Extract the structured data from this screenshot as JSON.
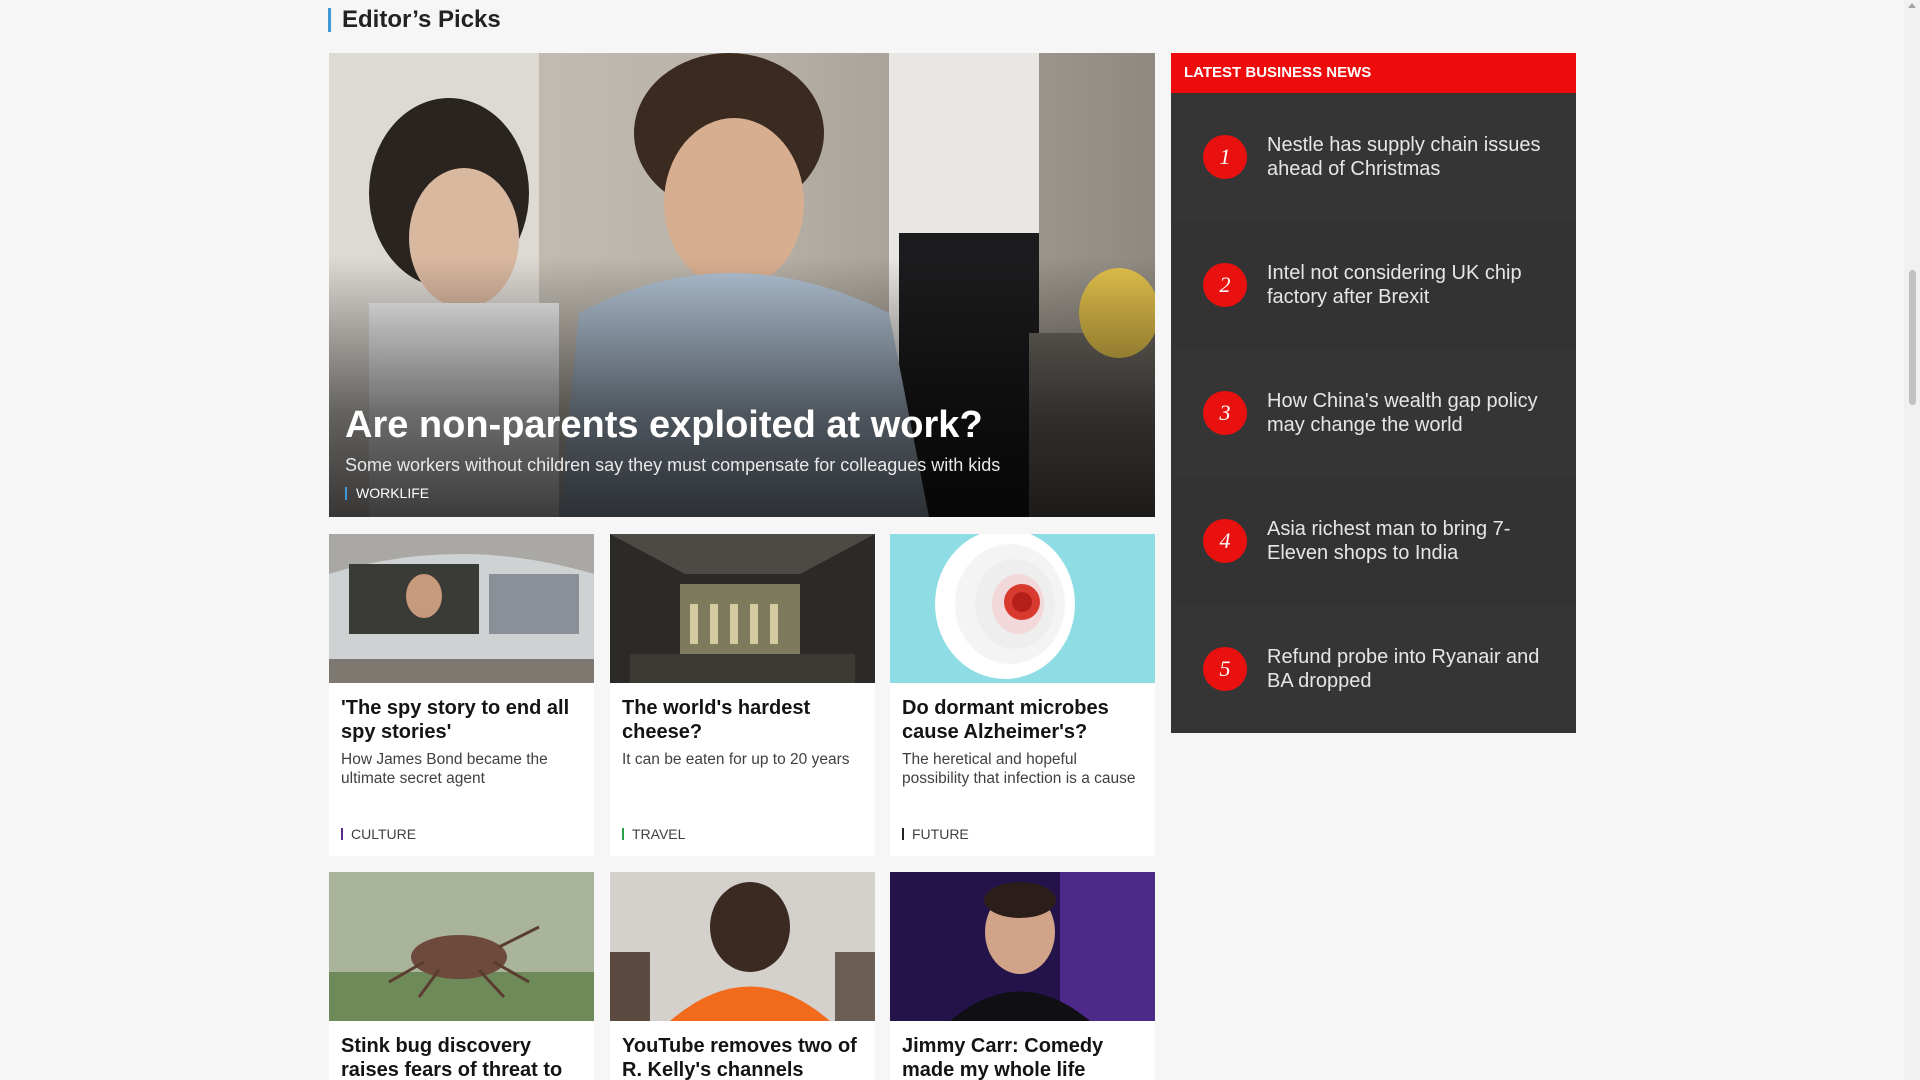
{
  "section": {
    "title": "Editor’s Picks"
  },
  "hero": {
    "title": "Are non-parents exploited at work?",
    "summary": "Some workers without children say they must compensate for colleagues with kids",
    "tag": "WORKLIFE",
    "image": "office-workers-photo"
  },
  "cards": [
    {
      "title": "'The spy story to end all spy stories'",
      "summary": "How James Bond became the ultimate secret agent",
      "tag": "CULTURE",
      "image": "man-in-car-photo"
    },
    {
      "title": "The world's hardest cheese?",
      "summary": "It can be eaten for up to 20 years",
      "tag": "TRAVEL",
      "image": "cheese-drying-photo"
    },
    {
      "title": "Do dormant microbes cause Alzheimer's?",
      "summary": "The heretical and hopeful possibility that infection is a cause",
      "tag": "FUTURE",
      "image": "head-illustration"
    },
    {
      "title": "Stink bug discovery raises fears of threat to",
      "summary": "",
      "tag": "",
      "image": "stink-bug-photo"
    },
    {
      "title": "YouTube removes two of R. Kelly's channels",
      "summary": "",
      "tag": "",
      "image": "man-orange-jumpsuit-photo"
    },
    {
      "title": "Jimmy Carr: Comedy made my whole life",
      "summary": "",
      "tag": "",
      "image": "comedian-stage-photo"
    }
  ],
  "latest": {
    "header": "LATEST BUSINESS NEWS",
    "items": [
      {
        "num": "1",
        "text": "Nestle has supply chain issues ahead of Christmas"
      },
      {
        "num": "2",
        "text": "Intel not considering UK chip factory after Brexit"
      },
      {
        "num": "3",
        "text": "How China's wealth gap policy may change the world"
      },
      {
        "num": "4",
        "text": "Asia richest man to bring 7-Eleven shops to India"
      },
      {
        "num": "5",
        "text": "Refund probe into Ryanair and BA dropped"
      }
    ]
  },
  "colors": {
    "accent_blue": "#3e9ad6",
    "news_red": "#ee0b0b",
    "news_bg": "#353535"
  }
}
